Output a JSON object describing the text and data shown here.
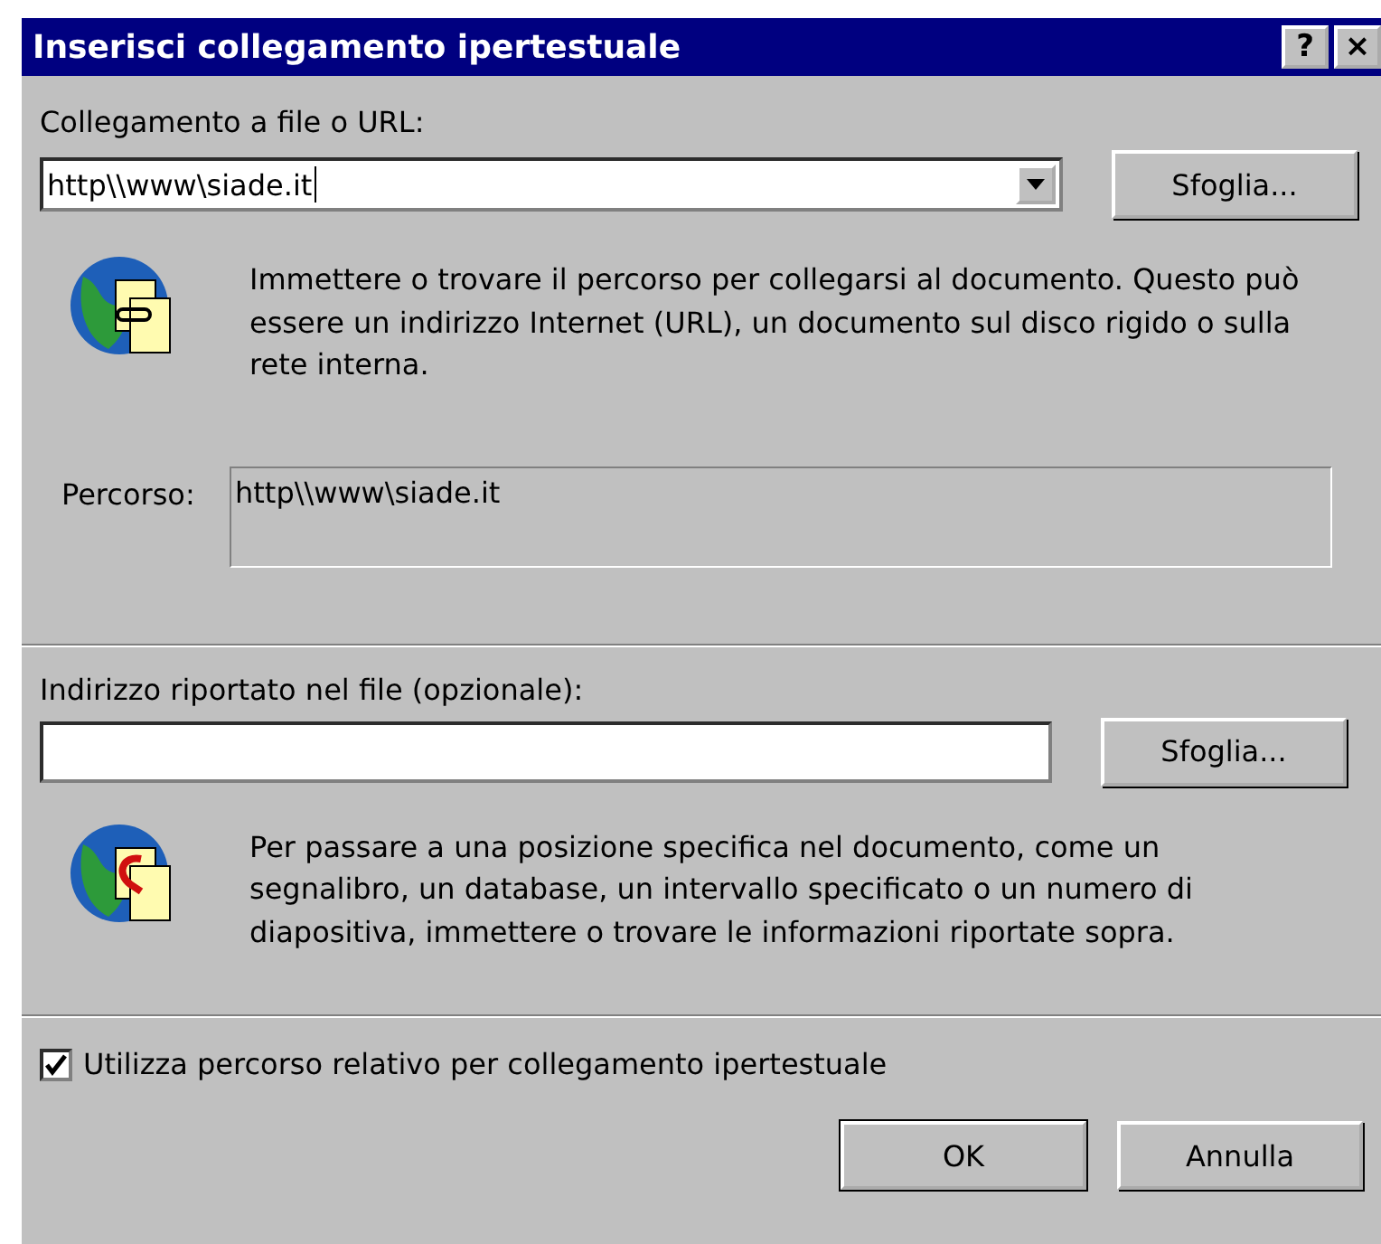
{
  "window": {
    "title": "Inserisci collegamento ipertestuale",
    "title_buttons": [
      "?",
      "×"
    ]
  },
  "link": {
    "label": "Collegamento a file o URL:",
    "value": "http\\\\www\\siade.it",
    "browse": "Sfoglia...",
    "description": "Immettere o trovare il percorso per collegarsi al documento. Questo può essere un indirizzo Internet (URL), un documento sul disco rigido o sulla rete interna.",
    "path_label": "Percorso:",
    "path_value": "http\\\\www\\siade.it"
  },
  "anchor": {
    "label": "Indirizzo riportato nel file (opzionale):",
    "browse": "Sfoglia...",
    "description": "Per passare a una posizione specifica nel documento, come un segnalibro, un database, un intervallo specificato o un numero di diapositiva, immettere o trovare le informazioni riportate sopra."
  },
  "relative_path": {
    "label": "Utilizza percorso relativo per collegamento ipertestuale",
    "checked": true
  },
  "buttons": [
    "OK",
    "Annulla"
  ]
}
